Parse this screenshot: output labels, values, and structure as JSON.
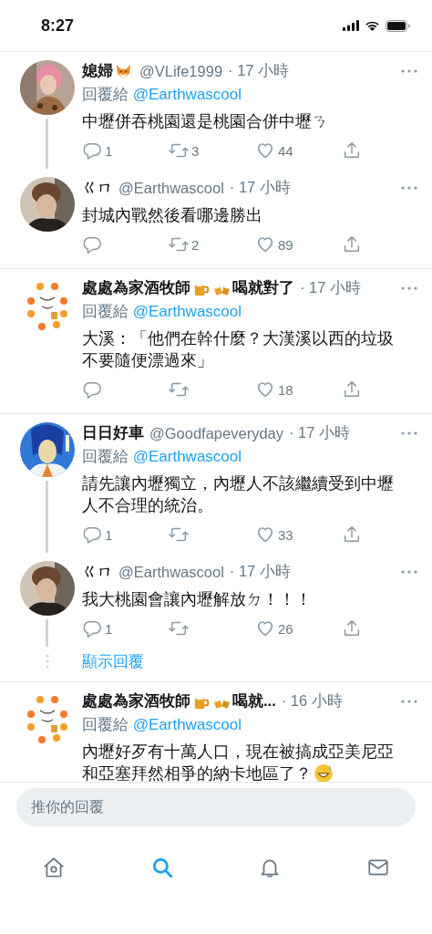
{
  "status_bar": {
    "time": "8:27"
  },
  "threads": [
    {
      "tweets": [
        {
          "avatar": {
            "kind": "picture"
          },
          "name_parts": [
            {
              "kind": "text",
              "text": "媳婦"
            },
            {
              "kind": "fox"
            }
          ],
          "handle": "@VLife1999",
          "time": "· 17 小時",
          "reply_to": {
            "label": "回覆給",
            "handle": "@Earthwascool"
          },
          "body_parts": [
            {
              "kind": "text",
              "text": "中壢併吞桃園還是桃園合併中壢ㄋ"
            }
          ],
          "actions": {
            "reply": "1",
            "retweet": "3",
            "like": "44"
          },
          "thread_line": true
        },
        {
          "avatar": {
            "kind": "picture"
          },
          "name_parts": [
            {
              "kind": "text",
              "text": "ㄍㄇ"
            }
          ],
          "handle": "@Earthwascool",
          "time": "· 17 小時",
          "body_parts": [
            {
              "kind": "text",
              "text": "封城內戰然後看哪邊勝出"
            }
          ],
          "actions": {
            "retweet": "2",
            "like": "89"
          },
          "thread_line": false
        }
      ]
    },
    {
      "tweets": [
        {
          "avatar": {
            "kind": "picture"
          },
          "name_parts": [
            {
              "kind": "text",
              "text": "處處為家酒牧師"
            },
            {
              "kind": "beer"
            },
            {
              "kind": "cheers"
            },
            {
              "kind": "text",
              "text": "喝就對了"
            }
          ],
          "time": "· 17 小時",
          "reply_to": {
            "label": "回覆給",
            "handle": "@Earthwascool"
          },
          "body_parts": [
            {
              "kind": "text",
              "text": "大溪：「他們在幹什麼？大漢溪以西的垃圾不要隨便漂過來」"
            }
          ],
          "actions": {
            "like": "18"
          },
          "thread_line": false
        }
      ]
    },
    {
      "tweets": [
        {
          "avatar": {
            "kind": "picture"
          },
          "name_parts": [
            {
              "kind": "text",
              "text": "日日好車"
            }
          ],
          "handle": "@Goodfapeveryday",
          "time": "· 17 小時",
          "reply_to": {
            "label": "回覆給",
            "handle": "@Earthwascool"
          },
          "body_parts": [
            {
              "kind": "text",
              "text": "請先讓內壢獨立，內壢人不該繼續受到中壢人不合理的統治。"
            }
          ],
          "actions": {
            "reply": "1",
            "like": "33"
          },
          "thread_line": true
        },
        {
          "avatar": {
            "kind": "picture"
          },
          "name_parts": [
            {
              "kind": "text",
              "text": "ㄍㄇ"
            }
          ],
          "handle": "@Earthwascool",
          "time": "· 17 小時",
          "body_parts": [
            {
              "kind": "text",
              "text": "我大桃園會讓內壢解放ㄉ！！！"
            }
          ],
          "actions": {
            "reply": "1",
            "like": "26"
          },
          "thread_line": true
        }
      ],
      "show_replies": "顯示回覆"
    },
    {
      "tweets": [
        {
          "avatar": {
            "kind": "picture"
          },
          "name_parts": [
            {
              "kind": "text",
              "text": "處處為家酒牧師"
            },
            {
              "kind": "beer"
            },
            {
              "kind": "cheers"
            },
            {
              "kind": "text",
              "text": "喝就..."
            }
          ],
          "time": "· 16 小時",
          "reply_to": {
            "label": "回覆給",
            "handle": "@Earthwascool"
          },
          "body_parts": [
            {
              "kind": "text",
              "text": "內壢好歹有十萬人口，現在被搞成亞美尼亞"
            },
            {
              "kind": "text",
              "text": "和亞塞拜然相爭的納卡地區了？"
            },
            {
              "kind": "sweat-smile"
            }
          ],
          "thread_line": false
        }
      ]
    }
  ],
  "reply_field": {
    "placeholder": "推你的回覆"
  },
  "tab_bar": [
    {
      "kind": "home",
      "selected": false
    },
    {
      "kind": "search",
      "selected": true
    },
    {
      "kind": "notifications",
      "selected": false
    },
    {
      "kind": "messages",
      "selected": false
    }
  ]
}
